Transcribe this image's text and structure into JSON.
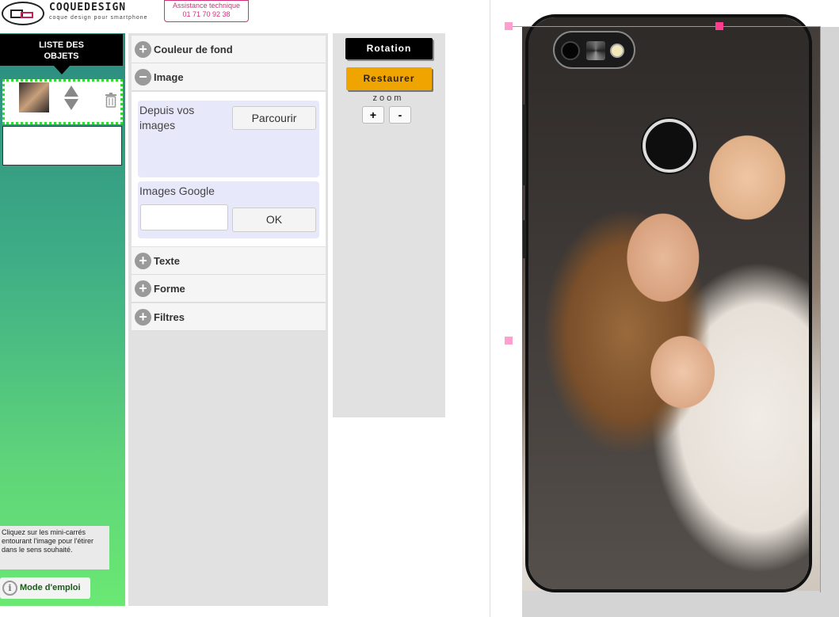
{
  "header": {
    "brand": "COQUEDESIGN",
    "tagline": "coque design pour smartphone",
    "assistance_label": "Assistance technique",
    "assistance_phone": "01 71 70 92 38"
  },
  "left_panel": {
    "list_title_line1": "LISTE DES",
    "list_title_line2": "OBJETS",
    "help_text": "Cliquez sur les mini-carrés entourant l'image pour l'étirer dans le sens souhaité.",
    "mode_emploi_label": "Mode d'emploi"
  },
  "accordion": {
    "couleur_label": "Couleur de fond",
    "image_label": "Image",
    "texte_label": "Texte",
    "forme_label": "Forme",
    "filtres_label": "Filtres",
    "depuis_label": "Depuis vos images",
    "parcourir_label": "Parcourir",
    "google_label": "Images Google",
    "ok_label": "OK"
  },
  "tools": {
    "rotation_label": "Rotation",
    "restaurer_label": "Restaurer",
    "zoom_label": "zoom",
    "zoom_plus": "+",
    "zoom_minus": "-"
  },
  "icons": {
    "plus": "+",
    "minus": "−",
    "info": "i"
  },
  "colors": {
    "accent_pink": "#d0307a",
    "restaurer": "#f0a400",
    "selection_green": "#39d639"
  }
}
